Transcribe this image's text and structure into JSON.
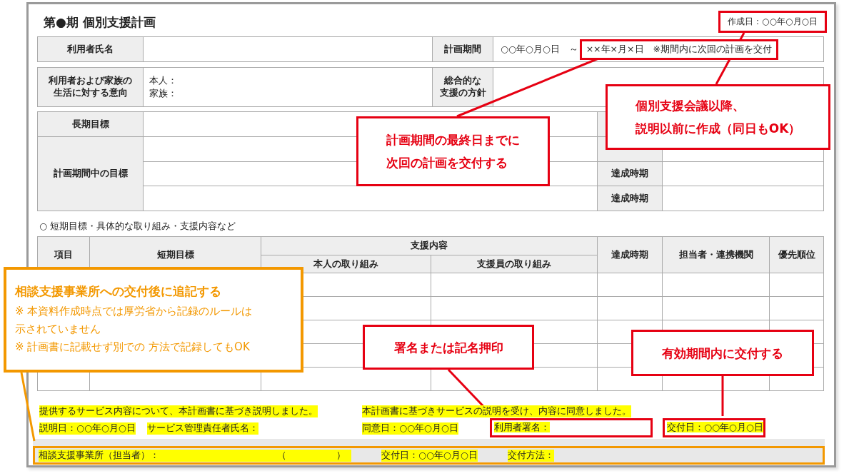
{
  "title": "第●期 個別支援計画",
  "created_date": "作成日：○○年○月○日",
  "profile": {
    "name_label": "利用者氏名",
    "period_label": "計画期間",
    "period_start": "○○年○月○日　～",
    "period_end": "××年×月×日　※期間内に次回の計画を交付",
    "intent_label": [
      "利用者および家族の",
      "生活に対する意向"
    ],
    "intent_lines": [
      "本人：",
      "家族："
    ],
    "policy_label": [
      "総合的な",
      "支援の方針"
    ]
  },
  "goals": {
    "long_term_label": "長期目標",
    "period_goal_label": "計画期間中の目標",
    "due_labels": [
      "達成時期",
      "達成時期"
    ]
  },
  "short_term": {
    "caption": "○ 短期目標・具体的な取り組み・支援内容など",
    "item_header": "項目",
    "goal_header": "短期目標",
    "group_header": "支援内容",
    "sub_headers": [
      "本人の取り組み",
      "支援員の取り組み"
    ],
    "tail_headers": [
      "達成時期",
      "担当者・連携機関",
      "優先順位"
    ]
  },
  "signatures": {
    "explain_sentence": "提供するサービス内容について、本計画書に基づき説明しました。",
    "explain_date": "説明日：○○年○月○日",
    "manager_label": "サービス管理責任者氏名：",
    "agree_sentence": "本計画書に基づきサービスの説明を受け、内容に同意しました。",
    "agree_date": "同意日：○○年○月○日",
    "user_sign_label": "利用者署名：",
    "delivery_date": "交付日：○○年○月○日"
  },
  "consult": {
    "office_label": "相談支援事業所（担当者）：",
    "paren_open": "（",
    "paren_close": "）",
    "delivery_date": "交付日：○○年○月○日",
    "method_label": "交付方法："
  },
  "callouts": [
    {
      "kind": "red",
      "lines": [
        "計画期間の最終日までに",
        "次回の計画を交付する"
      ]
    },
    {
      "kind": "red",
      "lines": [
        "個別支援会議以降、",
        "説明以前に作成（同日もOK）"
      ]
    },
    {
      "kind": "orange",
      "title": "相談支援事業所への交付後に追記する",
      "notes": [
        "※ 本資料作成時点では厚労省から記録のルールは示されていません",
        "※ 計画書に記載せず別での 方法で記録してもOK"
      ]
    },
    {
      "kind": "red",
      "lines": [
        "署名または記名押印"
      ]
    },
    {
      "kind": "red",
      "lines": [
        "有効期間内に交付する"
      ]
    }
  ]
}
